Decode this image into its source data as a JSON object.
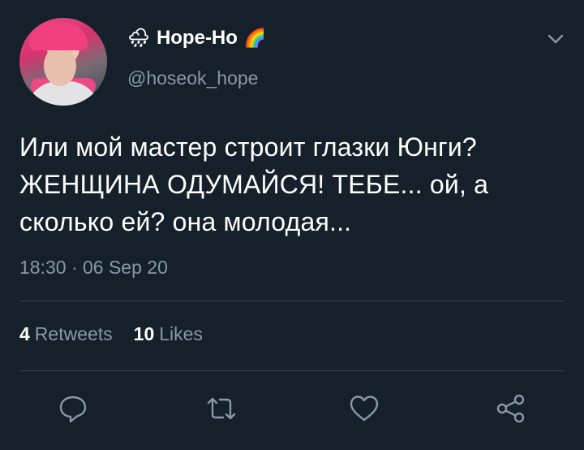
{
  "author": {
    "display_name": "Hope-Ho",
    "name_prefix_emoji": "🌧",
    "name_suffix_emoji": "🌈",
    "handle": "@hoseok_hope"
  },
  "tweet": {
    "text": "Или мой мастер строит глазки Юнги? ЖЕНЩИНА ОДУМАЙСЯ! ТЕБЕ... ой, а сколько ей? она молодая...",
    "timestamp": "18:30 · 06 Sep 20"
  },
  "stats": {
    "retweets_count": "4",
    "retweets_label": "Retweets",
    "likes_count": "10",
    "likes_label": "Likes"
  },
  "icons": {
    "more": "chevron-down-icon",
    "reply": "reply-icon",
    "retweet": "retweet-icon",
    "like": "heart-icon",
    "share": "share-icon"
  },
  "colors": {
    "background": "#15202b",
    "text": "#ffffff",
    "secondary_text": "#8899a6",
    "divider": "#38444d"
  }
}
